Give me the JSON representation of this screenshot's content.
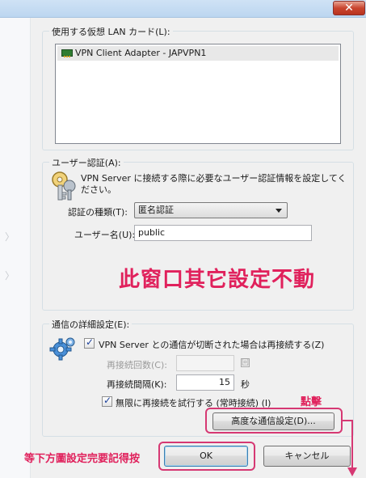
{
  "window": {
    "close_glyph": "✕"
  },
  "adapter": {
    "group_title": "使用する仮想 LAN カード(L):",
    "items": [
      "VPN Client Adapter - JAPVPN1"
    ]
  },
  "auth": {
    "group_title": "ユーザー認証(A):",
    "description_line1": "VPN Server に接続する際に必要なユーザー認証情報を設定してく",
    "description_line2": "ださい。",
    "type_label": "認証の種類(T):",
    "type_value": "匿名認証",
    "username_label": "ユーザー名(U):",
    "username_value": "public"
  },
  "advanced": {
    "group_title": "通信の詳細設定(E):",
    "reconnect_label": "VPN Server との通信が切断された場合は再接続する(Z)",
    "retry_count_label": "再接続回数(C):",
    "retry_count_unit": "回",
    "retry_interval_label": "再接続間隔(K):",
    "retry_interval_value": "15",
    "retry_interval_unit": "秒",
    "infinite_label": "無限に再接続を試行する (常時接続) (I)",
    "advanced_button": "高度な通信設定(D)..."
  },
  "buttons": {
    "ok": "OK",
    "cancel": "キャンセル"
  },
  "annotations": {
    "main": "此窗口其它設定不動",
    "click": "點擊",
    "ok_note": "等下方圖設定完要記得按"
  },
  "colors": {
    "annotation": "#e0215c"
  },
  "icons": [
    "close-icon",
    "network-adapter-icon",
    "key-icon",
    "gear-icon",
    "dropdown-arrow-icon",
    "check-icon"
  ]
}
